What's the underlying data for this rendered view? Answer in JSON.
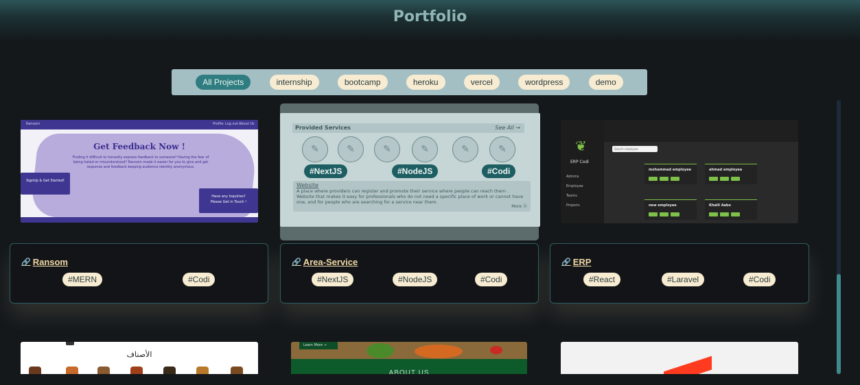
{
  "page": {
    "title": "Portfolio"
  },
  "filters": [
    {
      "label": "All Projects",
      "active": true
    },
    {
      "label": "internship"
    },
    {
      "label": "bootcamp"
    },
    {
      "label": "heroku"
    },
    {
      "label": "vercel"
    },
    {
      "label": "wordpress"
    },
    {
      "label": "demo"
    }
  ],
  "projects": [
    {
      "name": "Ransom",
      "tags": [
        "#MERN",
        "#Codi"
      ],
      "preview": {
        "nav_brand": "Ransom",
        "nav_links": [
          "Profile",
          "Log out",
          "About Us"
        ],
        "headline": "Get Feedback Now !",
        "text": "Finding it difficult to honestly express feedback to someone? Having the fear of being hated or misunderstood? Ransom made it easier for you to give and get response and feedback keeping audience identity anonymous.",
        "signup": "SignUp & Get Started!",
        "inquiry_title": "Have any Inquiries?",
        "inquiry_text": "Please Get in Touch !"
      }
    },
    {
      "name": "Area-Service",
      "tags": [
        "#NextJS",
        "#NodeJS",
        "#Codi"
      ],
      "preview": {
        "section": "Provided Services",
        "see_all": "See All →",
        "link": "Website",
        "description": "A place where providers can register and promote their service where people can reach them . Website that makes it easy for professionals who do not need a specific place of work or cannot have one, and for people who are searching for a service near them.",
        "more": "More ⓐ"
      }
    },
    {
      "name": "ERP",
      "tags": [
        "#React",
        "#Laravel",
        "#Codi"
      ],
      "preview": {
        "brand": "ERP Codi",
        "menu": [
          "Admins",
          "Employee",
          "Teams",
          "Projects"
        ],
        "search": "Search employee",
        "cards": [
          "mohammad employee",
          "ahmad employee",
          "new employee",
          "Khalil Aabo"
        ]
      }
    }
  ],
  "second_row": {
    "arabic_title": "الأصناف",
    "learn_more": "Learn More →",
    "about": "ABOUT US"
  }
}
